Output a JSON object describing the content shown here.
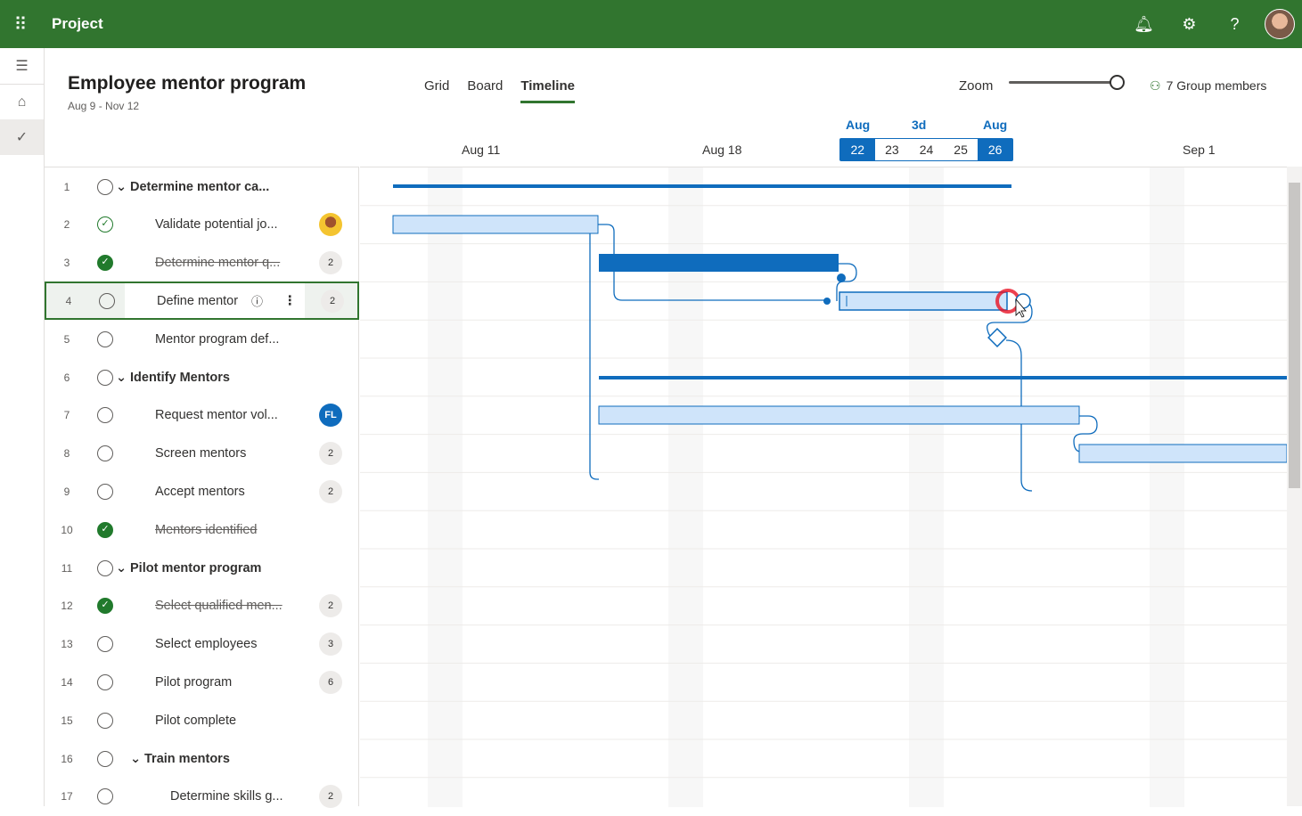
{
  "app": {
    "name": "Project"
  },
  "project": {
    "title": "Employee mentor program",
    "dates": "Aug 9 - Nov 12"
  },
  "tabs": [
    {
      "label": "Grid"
    },
    {
      "label": "Board"
    },
    {
      "label": "Timeline"
    }
  ],
  "zoom": {
    "label": "Zoom",
    "level": 1.0
  },
  "members": {
    "label": "7 Group members"
  },
  "timeline_header": {
    "weeks": [
      "Aug 11",
      "Aug 18",
      "Sep 1"
    ],
    "zoom_left": "Aug",
    "zoom_mid": "3d",
    "zoom_right": "Aug",
    "days": [
      "22",
      "23",
      "24",
      "25",
      "26"
    ]
  },
  "tasks": [
    {
      "num": "1",
      "name": "Determine mentor ca...",
      "status": "open",
      "type": "summary"
    },
    {
      "num": "2",
      "name": "Validate potential jo...",
      "status": "partial",
      "type": "task",
      "assignee": "photo"
    },
    {
      "num": "3",
      "name": "Determine mentor q...",
      "status": "done",
      "type": "task",
      "assignee": "2"
    },
    {
      "num": "4",
      "name": "Define mentor",
      "status": "open",
      "type": "task",
      "assignee": "2"
    },
    {
      "num": "5",
      "name": "Mentor program def...",
      "status": "open",
      "type": "task"
    },
    {
      "num": "6",
      "name": "Identify Mentors",
      "status": "open",
      "type": "summary"
    },
    {
      "num": "7",
      "name": "Request mentor vol...",
      "status": "open",
      "type": "task",
      "assignee": "FL"
    },
    {
      "num": "8",
      "name": "Screen mentors",
      "status": "open",
      "type": "task",
      "assignee": "2"
    },
    {
      "num": "9",
      "name": "Accept mentors",
      "status": "open",
      "type": "task",
      "assignee": "2"
    },
    {
      "num": "10",
      "name": "Mentors identified",
      "status": "done",
      "type": "task"
    },
    {
      "num": "11",
      "name": "Pilot mentor program",
      "status": "open",
      "type": "summary"
    },
    {
      "num": "12",
      "name": "Select qualified men...",
      "status": "done",
      "type": "task",
      "assignee": "2"
    },
    {
      "num": "13",
      "name": "Select employees",
      "status": "open",
      "type": "task",
      "assignee": "3"
    },
    {
      "num": "14",
      "name": "Pilot program",
      "status": "open",
      "type": "task",
      "assignee": "6"
    },
    {
      "num": "15",
      "name": "Pilot complete",
      "status": "open",
      "type": "task"
    },
    {
      "num": "16",
      "name": "Train mentors",
      "status": "open",
      "type": "summary2"
    },
    {
      "num": "17",
      "name": "Determine skills g...",
      "status": "open",
      "type": "sub",
      "assignee": "2"
    }
  ]
}
